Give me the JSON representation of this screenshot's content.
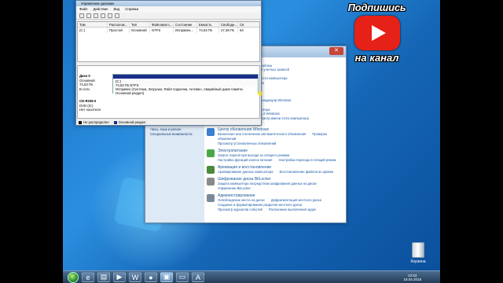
{
  "disk_management": {
    "title": "Управление дисками",
    "menu": [
      "Файл",
      "Действие",
      "Вид",
      "Справка"
    ],
    "table": {
      "headers": [
        "Том",
        "Располож...",
        "Тип",
        "Файловая с...",
        "Состояние",
        "Емкость",
        "Свободн...",
        "Св"
      ],
      "rows": [
        [
          "(C:)",
          "Простой",
          "Основной",
          "NTFS",
          "Исправен...",
          "74,53 ГБ",
          "47,38 ГБ",
          "64"
        ]
      ]
    },
    "disk0": {
      "name": "Диск 0",
      "type": "Основной",
      "size": "74,53 ГБ",
      "status": "В сети"
    },
    "partition": {
      "label": "(C:)",
      "size": "74,53 ГБ NTFS",
      "status": "Исправен (Система, Загрузка, Файл подкачки, Активен, Аварийный дамп памяти, Основной раздел)"
    },
    "cdrom": {
      "name": "CD-ROM 0",
      "type": "DVD (D:)",
      "status": "Нет носителя"
    },
    "legend": [
      "Не распределен",
      "Основной раздел"
    ]
  },
  "control_panel": {
    "left_links": [
      {
        "label": "Оформление и персонализация",
        "sub": ""
      },
      {
        "label": "Часы, язык и регион",
        "sub": ""
      },
      {
        "label": "Специальные возможности",
        "sub": ""
      }
    ],
    "top_fragments": [
      "...ера",
      "...вание проблем",
      "...контроля учетных записей",
      "...ьютера",
      "...рительности компьютера",
      "...мпьютера",
      "...ы",
      "...ограмм",
      "...ление",
      "...через брандмауэр Windows",
      "...ows",
      "...о компьютера",
      "...осталось в Windows",
      "...ера  Просмотр имени этого компьютера",
      "...ств"
    ],
    "sections": [
      {
        "heading": "Центр обновления Windows",
        "links": [
          "Включение или отключение автоматического обновления",
          "Проверка обновлений",
          "Просмотр установленных обновлений"
        ],
        "color": "#3a7fd0"
      },
      {
        "heading": "Электропитание",
        "links": [
          "Запрос пароля при выходе из спящего режима",
          "Настройка функций кнопок питания",
          "Настройка перехода в спящий режим"
        ],
        "color": "#4aa84a"
      },
      {
        "heading": "Архивация и восстановление",
        "links": [
          "Архивирование данных компьютера",
          "Восстановление файлов из архива"
        ],
        "color": "#4a8a3a"
      },
      {
        "heading": "Шифрование диска BitLocker",
        "links": [
          "Защита компьютера посредством шифрования данных на диске",
          "Управление BitLocker"
        ],
        "color": "#8a8a8a"
      },
      {
        "heading": "Администрирование",
        "links": [
          "Освобождение места на диске",
          "Дефрагментация жесткого диска",
          "Создание и форматирование разделов жесткого диска",
          "Просмотр журналов событий",
          "Расписание выполнения задач"
        ],
        "color": "#7a8a9a"
      }
    ]
  },
  "desktop": {
    "recycle_bin": "Корзина"
  },
  "taskbar": {
    "clock": "22:53",
    "date": "18.04.2018",
    "apps": [
      "ie-icon",
      "explorer-icon",
      "media-icon",
      "word-icon",
      "chrome-icon",
      "computer-icon",
      "disk-icon",
      "adobe-icon"
    ]
  },
  "overlay": {
    "top": "Подпишись",
    "bottom": "на канал"
  }
}
